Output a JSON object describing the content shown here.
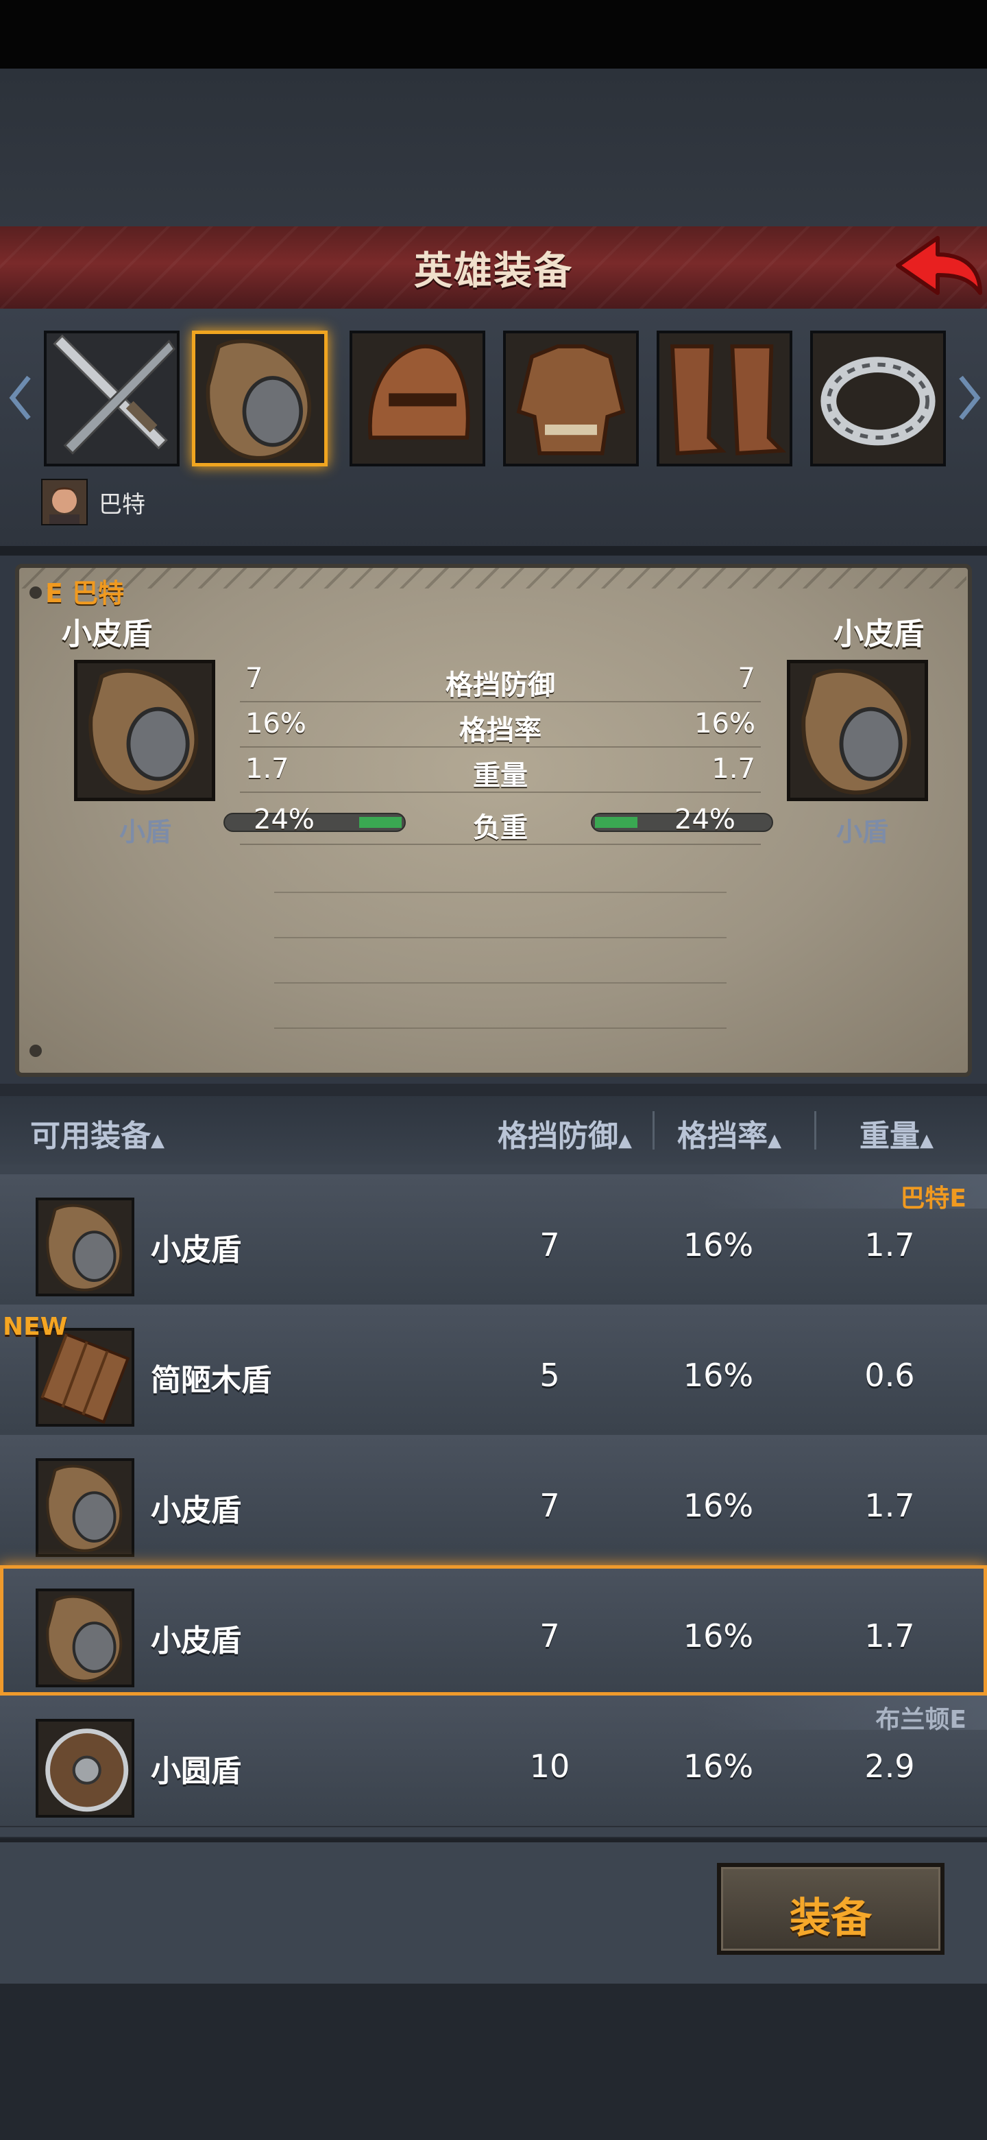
{
  "header": {
    "title": "英雄装备"
  },
  "slots": [
    {
      "icon": "sword-icon"
    },
    {
      "icon": "shield-icon",
      "selected": true
    },
    {
      "icon": "helmet-icon"
    },
    {
      "icon": "armor-icon"
    },
    {
      "icon": "boots-icon"
    },
    {
      "icon": "ring-icon"
    }
  ],
  "hero": {
    "name": "巴特"
  },
  "compare": {
    "owner_tag": "E 巴特",
    "left": {
      "name": "小皮盾",
      "type": "小盾",
      "load": "24%"
    },
    "right": {
      "name": "小皮盾",
      "type": "小盾",
      "load": "24%"
    },
    "stats": [
      {
        "label": "格挡防御",
        "left": "7",
        "right": "7"
      },
      {
        "label": "格挡率",
        "left": "16%",
        "right": "16%"
      },
      {
        "label": "重量",
        "left": "1.7",
        "right": "1.7"
      },
      {
        "label": "负重",
        "left": "24%",
        "right": "24%"
      }
    ],
    "load_fraction": 0.24
  },
  "list": {
    "headers": [
      "可用装备",
      "格挡防御",
      "格挡率",
      "重量"
    ],
    "sort_marker": "▲",
    "rows": [
      {
        "name": "小皮盾",
        "def": "7",
        "rate": "16%",
        "weight": "1.7",
        "equipped_by": "巴特E",
        "new": "",
        "icon": "leather-shield-icon"
      },
      {
        "name": "简陋木盾",
        "def": "5",
        "rate": "16%",
        "weight": "0.6",
        "equipped_by": "",
        "new": "NEW",
        "icon": "wooden-shield-icon"
      },
      {
        "name": "小皮盾",
        "def": "7",
        "rate": "16%",
        "weight": "1.7",
        "equipped_by": "",
        "new": "",
        "icon": "leather-shield-icon"
      },
      {
        "name": "小皮盾",
        "def": "7",
        "rate": "16%",
        "weight": "1.7",
        "equipped_by": "",
        "new": "",
        "icon": "leather-shield-icon",
        "selected": true
      },
      {
        "name": "小圆盾",
        "def": "10",
        "rate": "16%",
        "weight": "2.9",
        "equipped_by": "布兰顿E",
        "new": "",
        "icon": "round-shield-icon"
      }
    ]
  },
  "footer": {
    "equip_label": "装备"
  },
  "colors": {
    "accent": "#f0a520",
    "new": "#f5a623",
    "equipped": "#f09a20",
    "equipped_other": "#aab4c4"
  }
}
